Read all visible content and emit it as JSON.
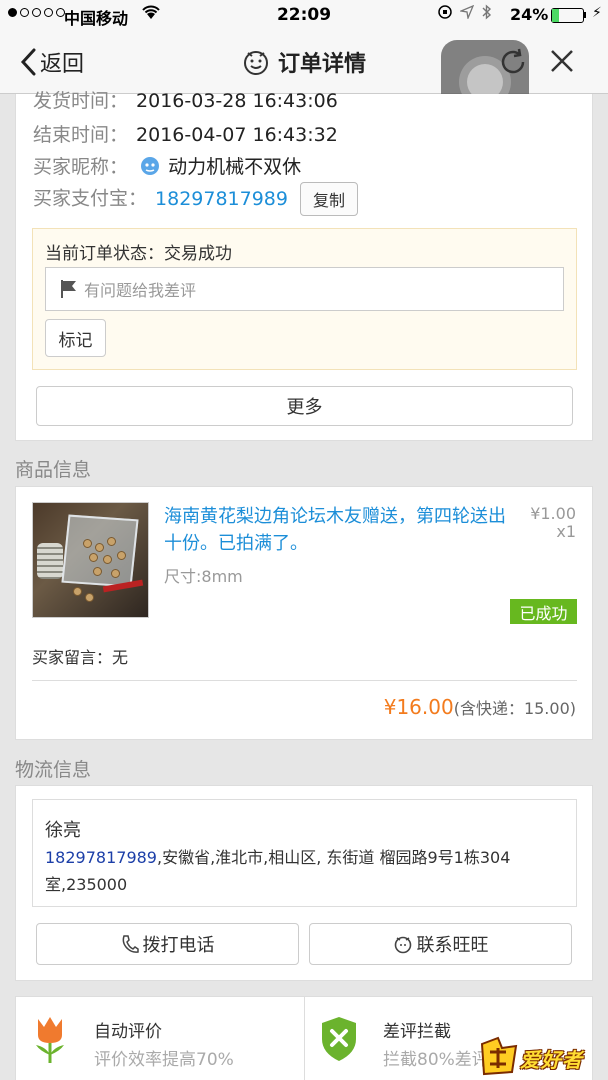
{
  "statusbar": {
    "carrier": "中国移动",
    "time": "22:09",
    "battery": "24%"
  },
  "nav": {
    "back_label": "返回",
    "title": "订单详情"
  },
  "order": {
    "ship_time_label": "发货时间：",
    "ship_time": "2016-03-28 16:43:06",
    "end_time_label": "结束时间：",
    "end_time": "2016-04-07 16:43:32",
    "buyer_nick_label": "买家昵称：",
    "buyer_nick": "动力机械不双休",
    "buyer_alipay_label": "买家支付宝：",
    "buyer_alipay": "18297817989",
    "copy_label": "复制",
    "status_text": "当前订单状态：交易成功",
    "complain_placeholder": "有问题给我差评",
    "mark_label": "标记",
    "more_label": "更多"
  },
  "product": {
    "section_title": "商品信息",
    "name": "海南黄花梨边角论坛木友赠送，第四轮送出十份。已拍满了。",
    "spec": "尺寸:8mm",
    "price": "¥1.00",
    "qty": "x1",
    "status_badge": "已成功",
    "buyer_msg": "买家留言：无",
    "total_amount": "¥16.00",
    "shipping": "(含快递：15.00)"
  },
  "logistics": {
    "section_title": "物流信息",
    "name": "徐亮",
    "phone": "18297817989",
    "address": ",安徽省,淮北市,相山区, 东街道 榴园路9号1栋304室,235000",
    "call_label": "拨打电话",
    "wangwang_label": "联系旺旺"
  },
  "tiles": [
    {
      "title": "自动评价",
      "sub": "评价效率提高70%"
    },
    {
      "title": "差评拦截",
      "sub": "拦截80%差评"
    }
  ],
  "watermark": "爱好者",
  "colors": {
    "link": "#1c8ed8",
    "price_orange": "#f37b1d",
    "success_green": "#67b81f",
    "phone_blue": "#1c3fa8"
  }
}
